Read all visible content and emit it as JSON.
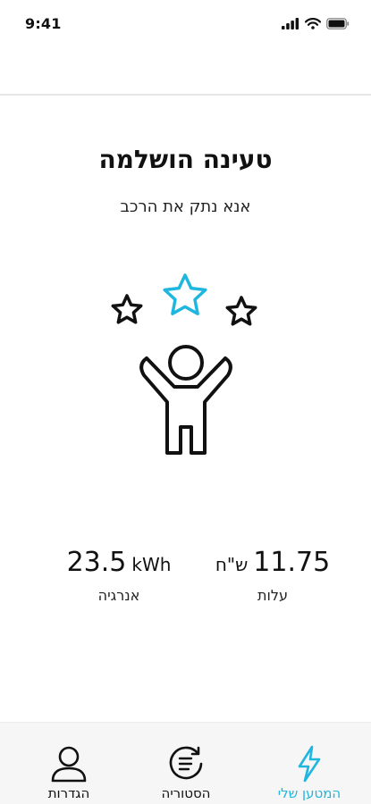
{
  "status_bar": {
    "time": "9:41",
    "icons": [
      "signal-icon",
      "wifi-icon",
      "battery-icon"
    ]
  },
  "main": {
    "title": "טעינה הושלמה",
    "subtitle": "אנא נתק את הרכב",
    "illustration": "person-celebrating-with-stars-icon"
  },
  "stats": {
    "cost": {
      "value": "11.75",
      "unit": "ש\"ח",
      "label": "עלות"
    },
    "energy": {
      "value": "23.5",
      "unit": "kWh",
      "label": "אנרגיה"
    }
  },
  "tab_bar": {
    "items": [
      {
        "label": "המטען שלי",
        "icon": "lightning-icon",
        "active": true
      },
      {
        "label": "הסטוריה",
        "icon": "history-icon",
        "active": false
      },
      {
        "label": "הגדרות",
        "icon": "user-icon",
        "active": false
      }
    ]
  },
  "colors": {
    "accent": "#1fb6e0",
    "text": "#111111",
    "tab_bar_bg": "#f6f6f6"
  }
}
